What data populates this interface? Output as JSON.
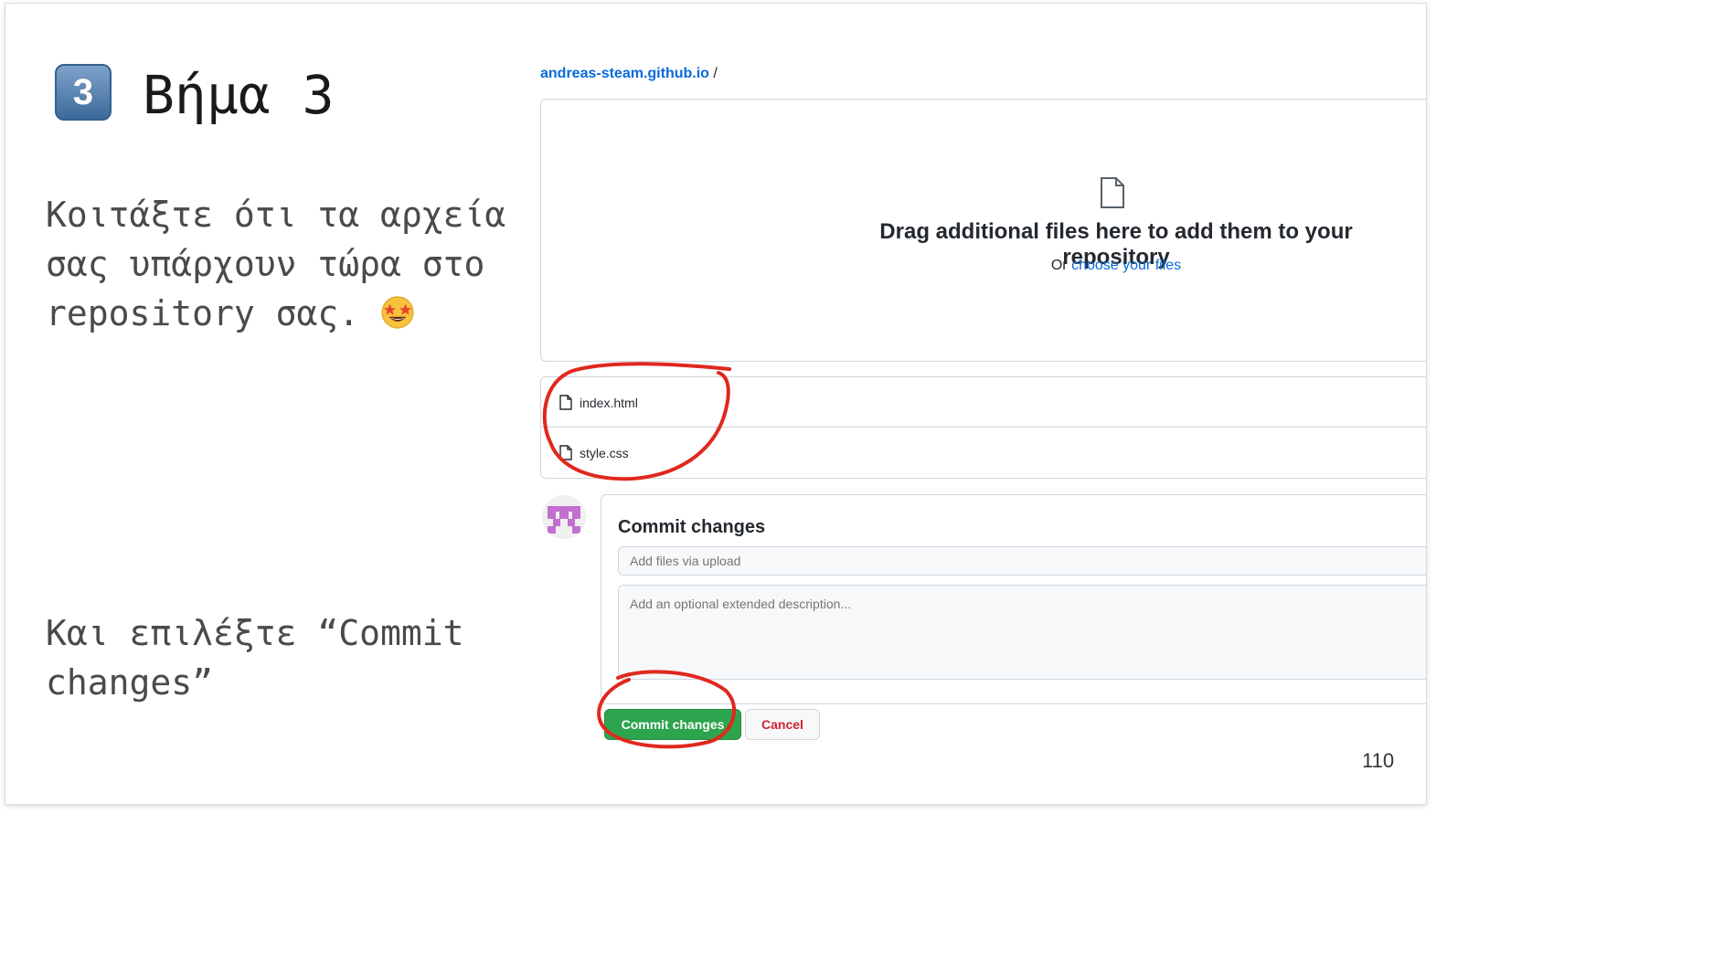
{
  "slide": {
    "step_badge": "3",
    "title": "Βήμα 3",
    "paragraph1": "Κοιτάξτε ότι τα αρχεία σας υπάρχουν τώρα στο repository σας.",
    "paragraph2": "Και επιλέξτε “Commit changes”",
    "page_number": "110",
    "emoji": "star-struck-face"
  },
  "github": {
    "breadcrumb": {
      "repo": "andreas-steam.github.io",
      "separator": "/"
    },
    "dropzone": {
      "icon": "file-icon",
      "title": "Drag additional files here to add them to your repository",
      "subtitle_prefix": "Or",
      "subtitle_link": "choose your files"
    },
    "files": [
      {
        "name": "index.html",
        "icon": "file-icon"
      },
      {
        "name": "style.css",
        "icon": "file-icon"
      }
    ],
    "commit": {
      "title": "Commit changes",
      "summary_placeholder": "Add files via upload",
      "description_placeholder": "Add an optional extended description...",
      "commit_button": "Commit changes",
      "cancel_button": "Cancel"
    }
  },
  "colors": {
    "link": "#0969da",
    "commit_green": "#2da44e",
    "cancel_red": "#cf222e",
    "annotation_red": "#e0281e"
  }
}
